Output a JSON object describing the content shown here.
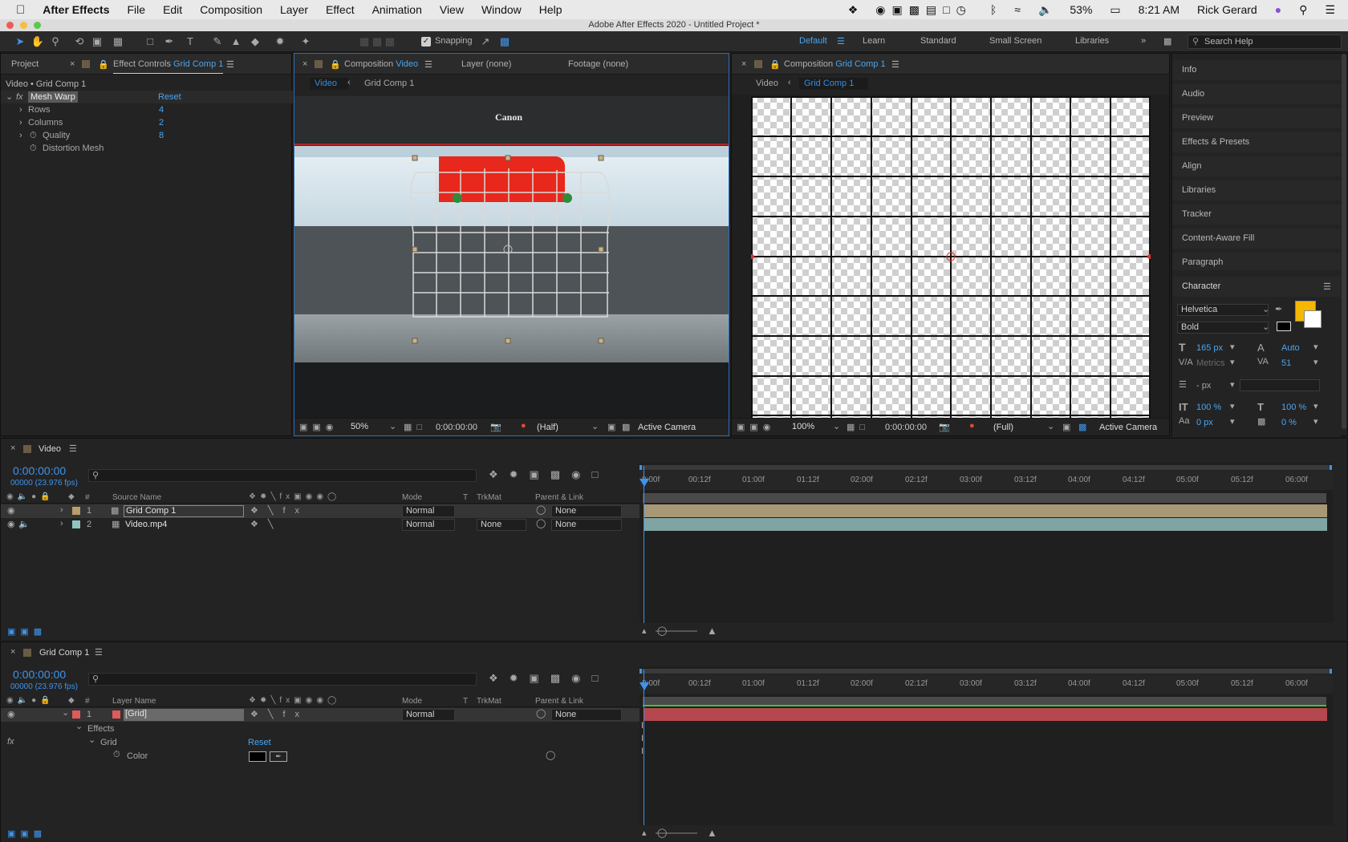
{
  "menubar": {
    "app_name": "After Effects",
    "items": [
      "File",
      "Edit",
      "Composition",
      "Layer",
      "Effect",
      "Animation",
      "View",
      "Window",
      "Help"
    ],
    "battery": "53%",
    "time": "8:21 AM",
    "user": "Rick Gerard"
  },
  "window_title": "Adobe After Effects 2020 - Untitled Project *",
  "toolbar": {
    "snapping": "Snapping",
    "workspaces": [
      "Default",
      "Learn",
      "Standard",
      "Small Screen",
      "Libraries"
    ],
    "active_workspace": "Default",
    "search_placeholder": "Search Help"
  },
  "effect_controls": {
    "tab_project": "Project",
    "tab_prefix": "Effect Controls",
    "tab_target": "Grid Comp 1",
    "breadcrumb": "Video • Grid Comp 1",
    "effect_name": "Mesh Warp",
    "reset": "Reset",
    "params": [
      {
        "name": "Rows",
        "value": "4"
      },
      {
        "name": "Columns",
        "value": "2"
      },
      {
        "name": "Quality",
        "value": "8"
      },
      {
        "name": "Distortion Mesh",
        "value": ""
      }
    ]
  },
  "comp_viewer_1": {
    "tab_prefix": "Composition",
    "tab_name": "Video",
    "tab_layer": "Layer (none)",
    "tab_footage": "Footage (none)",
    "flow_active": "Video",
    "flow_other": "Grid Comp 1",
    "printer_brand": "Canon",
    "zoom": "50%",
    "timecode": "0:00:00:00",
    "resolution": "(Half)",
    "camera": "Active Camera"
  },
  "comp_viewer_2": {
    "tab_prefix": "Composition",
    "tab_name": "Grid Comp 1",
    "flow_parent": "Video",
    "flow_active": "Grid Comp 1",
    "zoom": "100%",
    "timecode": "0:00:00:00",
    "resolution": "(Full)",
    "camera": "Active Camera"
  },
  "right_panels": {
    "items": [
      "Info",
      "Audio",
      "Preview",
      "Effects & Presets",
      "Align",
      "Libraries",
      "Tracker",
      "Content-Aware Fill",
      "Paragraph"
    ],
    "character_title": "Character",
    "font_family": "Helvetica",
    "font_style": "Bold",
    "font_size": "165 px",
    "leading": "Auto",
    "kerning": "Metrics",
    "tracking": "51",
    "stroke_width": "- px",
    "vert_scale": "100 %",
    "horiz_scale": "100 %",
    "baseline": "0 px",
    "tsume": "0 %",
    "fill_color": "#f5b800"
  },
  "timeline_video": {
    "tab_name": "Video",
    "timecode": "0:00:00:00",
    "fps": "00000 (23.976 fps)",
    "col_source": "Source Name",
    "col_mode": "Mode",
    "col_t": "T",
    "col_trkmat": "TrkMat",
    "col_parent": "Parent & Link",
    "col_num": "#",
    "ruler": [
      "0:00f",
      "00:12f",
      "01:00f",
      "01:12f",
      "02:00f",
      "02:12f",
      "03:00f",
      "03:12f",
      "04:00f",
      "04:12f",
      "05:00f",
      "05:12f",
      "06:00f"
    ],
    "layers": [
      {
        "num": "1",
        "name": "Grid Comp 1",
        "mode": "Normal",
        "trkmat": "",
        "parent": "None",
        "color": "#b79e6a"
      },
      {
        "num": "2",
        "name": "Video.mp4",
        "mode": "Normal",
        "trkmat": "None",
        "parent": "None",
        "color": "#8fc3c0"
      }
    ]
  },
  "timeline_grid": {
    "tab_name": "Grid Comp 1",
    "timecode": "0:00:00:00",
    "fps": "00000 (23.976 fps)",
    "col_layer": "Layer Name",
    "col_mode": "Mode",
    "col_t": "T",
    "col_trkmat": "TrkMat",
    "col_parent": "Parent & Link",
    "col_num": "#",
    "ruler": [
      "0:00f",
      "00:12f",
      "01:00f",
      "01:12f",
      "02:00f",
      "02:12f",
      "03:00f",
      "03:12f",
      "04:00f",
      "04:12f",
      "05:00f",
      "05:12f",
      "06:00f"
    ],
    "layer": {
      "num": "1",
      "name": "[Grid]",
      "mode": "Normal",
      "parent": "None",
      "color": "#e05a5a"
    },
    "effects_label": "Effects",
    "grid_label": "Grid",
    "reset": "Reset",
    "color_label": "Color"
  }
}
